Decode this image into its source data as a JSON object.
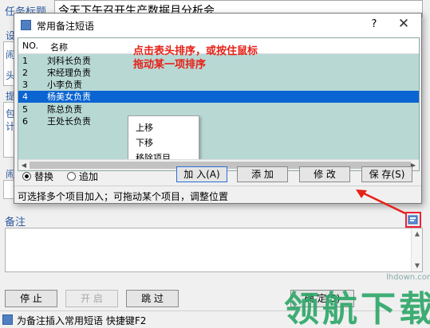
{
  "main": {
    "task_label": "任务标题",
    "task_title": "今天下午召开生产数据月分析会",
    "side_labels": [
      "设",
      "闹",
      "头",
      "提",
      "包",
      "计",
      "闹"
    ],
    "notes_label": "备注",
    "buttons": {
      "stop": "停  止",
      "start": "开  启",
      "skip": "跳  过",
      "confirm": "确  定(S)"
    },
    "status": "为备注插入常用短语 快捷键F2"
  },
  "dialog": {
    "title": "常用备注短语",
    "help": "?",
    "close": "✕",
    "col_no": "NO.",
    "col_name": "名称",
    "rows": [
      {
        "no": "1",
        "name": "刘科长负责"
      },
      {
        "no": "2",
        "name": "宋经理负责"
      },
      {
        "no": "3",
        "name": "小李负责"
      },
      {
        "no": "4",
        "name": "杨美女负责",
        "selected": true
      },
      {
        "no": "5",
        "name": "陈总负责"
      },
      {
        "no": "6",
        "name": "王处长负责"
      }
    ],
    "hint_line1": "点击表头排序，或按住鼠标",
    "hint_line2": "拖动某一项排序",
    "context_menu": [
      "上移",
      "下移",
      "移除项目"
    ],
    "radio_replace": "替换",
    "radio_append": "追加",
    "btn_add": "加 入(A)",
    "btn_add2": "添 加",
    "btn_modify": "修 改",
    "btn_save": "保 存(S)",
    "status": "可选择多个项目加入；可拖动某个项目，调整位置"
  },
  "watermark": {
    "text": "领航下载",
    "url": "lhdown.com"
  },
  "colors": {
    "list_bg": "#b8d8d4",
    "selection": "#0a64d2",
    "hint": "#e62117",
    "accent_label": "#2d5aa0",
    "highlight_box": "#ee2233"
  }
}
